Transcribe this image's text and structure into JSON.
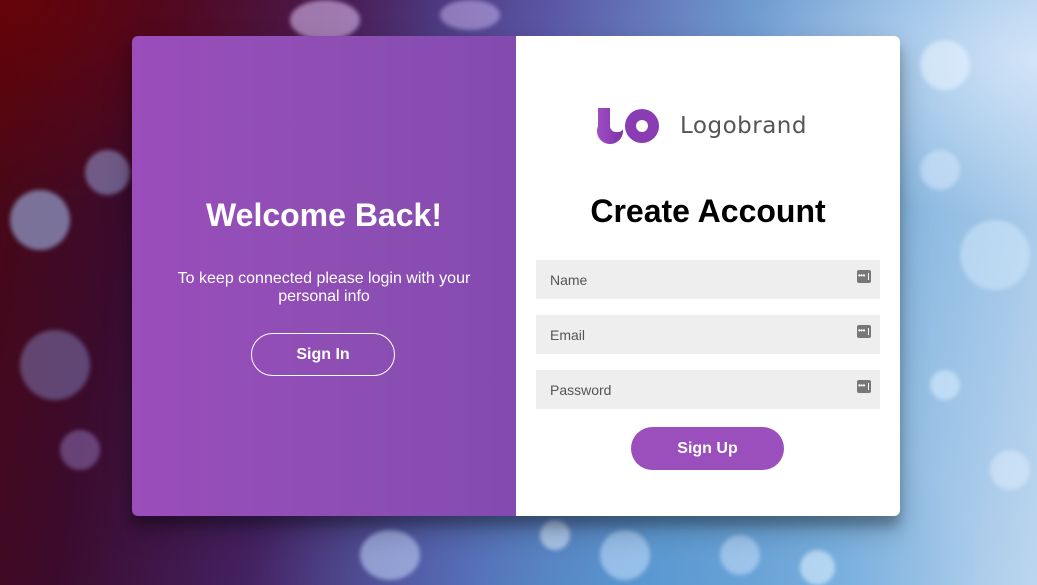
{
  "left_panel": {
    "heading": "Welcome Back!",
    "message": "To keep connected please login with your personal info",
    "sign_in_label": "Sign In"
  },
  "right_panel": {
    "brand_name": "Logobrand",
    "logo_icon": "logobrand-infinity-icon",
    "heading": "Create Account",
    "fields": [
      {
        "placeholder": "Name",
        "value": "",
        "icon": "password-manager-icon"
      },
      {
        "placeholder": "Email",
        "value": "",
        "icon": "password-manager-icon"
      },
      {
        "placeholder": "Password",
        "value": "",
        "icon": "password-manager-icon"
      }
    ],
    "sign_up_label": "Sign Up"
  },
  "colors": {
    "accent": "#9b4fbd",
    "left_panel_start": "#9a4dbb",
    "left_panel_end": "#844ab0",
    "input_bg": "#eeeeee",
    "logo_text": "#555555"
  }
}
